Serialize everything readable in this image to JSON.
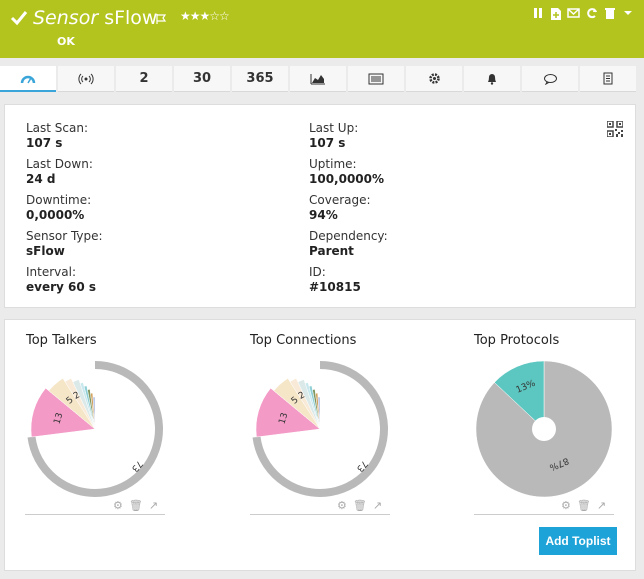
{
  "header": {
    "title_italic": "Sensor",
    "title_name": "sFlow",
    "status": "OK",
    "stars": "★★★☆☆",
    "actions": [
      "pause-icon",
      "report-icon",
      "email-icon",
      "refresh-icon",
      "delete-icon"
    ]
  },
  "tabs": [
    {
      "icon": "gauge-icon",
      "label": ""
    },
    {
      "icon": "live-icon",
      "label": ""
    },
    {
      "icon": "",
      "label": "2"
    },
    {
      "icon": "",
      "label": "30"
    },
    {
      "icon": "",
      "label": "365"
    },
    {
      "icon": "graph-icon",
      "label": ""
    },
    {
      "icon": "log-icon",
      "label": ""
    },
    {
      "icon": "settings-icon",
      "label": ""
    },
    {
      "icon": "bell-icon",
      "label": ""
    },
    {
      "icon": "comment-icon",
      "label": ""
    },
    {
      "icon": "history-icon",
      "label": ""
    }
  ],
  "info": {
    "last_scan_label": "Last Scan:",
    "last_scan": "107 s",
    "last_up_label": "Last Up:",
    "last_up": "107 s",
    "last_down_label": "Last Down:",
    "last_down": "24 d",
    "uptime_label": "Uptime:",
    "uptime": "100,0000%",
    "downtime_label": "Downtime:",
    "downtime": "0,0000%",
    "coverage_label": "Coverage:",
    "coverage": "94%",
    "sensor_type_label": "Sensor Type:",
    "sensor_type": "sFlow",
    "dependency_label": "Dependency:",
    "dependency": "Parent",
    "interval_label": "Interval:",
    "interval": "every 60 s",
    "id_label": "ID:",
    "id": "#10815"
  },
  "toplists": {
    "add_button": "Add Toplist",
    "talkers_title": "Top Talkers",
    "connections_title": "Top Connections",
    "protocols_title": "Top Protocols"
  },
  "chart_data": [
    {
      "type": "pie",
      "title": "Top Talkers",
      "values": [
        73,
        13,
        5,
        2,
        2,
        1,
        1,
        1,
        1,
        1
      ],
      "labels": [
        "73",
        "13",
        "5",
        "2",
        "",
        "",
        "",
        "",
        "",
        ""
      ],
      "colors": [
        "#b9b9b9",
        "#f39ac6",
        "#f5e6c8",
        "#f8ead6",
        "#dce9e9",
        "#c9e8ee",
        "#8fcfd6",
        "#7f9660",
        "#d3a35f",
        "#a9b8e0"
      ]
    },
    {
      "type": "pie",
      "title": "Top Connections",
      "values": [
        73,
        13,
        5,
        2,
        2,
        1,
        1,
        1,
        1,
        1
      ],
      "labels": [
        "73",
        "13",
        "5",
        "2",
        "",
        "",
        "",
        "",
        "",
        ""
      ],
      "colors": [
        "#b9b9b9",
        "#f39ac6",
        "#f5e6c8",
        "#f8ead6",
        "#dce9e9",
        "#c9e8ee",
        "#8fcfd6",
        "#7f9660",
        "#d3a35f",
        "#a9b8e0"
      ]
    },
    {
      "type": "pie",
      "title": "Top Protocols",
      "values": [
        87,
        13
      ],
      "labels": [
        "87%",
        "13%"
      ],
      "colors": [
        "#b9b9b9",
        "#5cc6c0"
      ]
    }
  ]
}
